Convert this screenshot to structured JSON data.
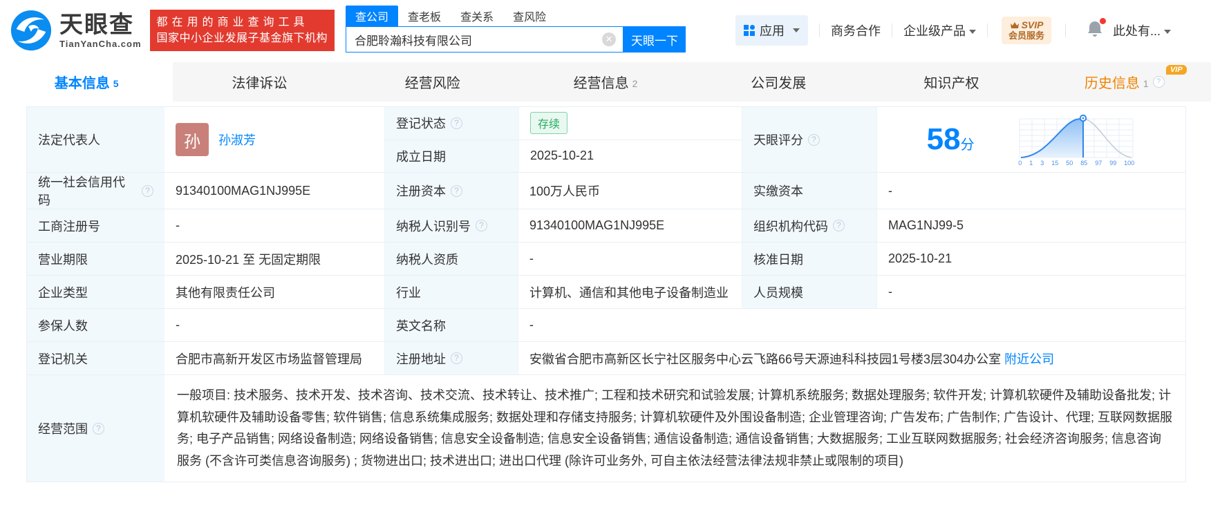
{
  "header": {
    "brand_cn": "天眼查",
    "brand_en": "TianYanCha.com",
    "slogan_line1": "都在用的商业查询工具",
    "slogan_line2": "国家中小企业发展子基金旗下机构",
    "search": {
      "tabs": [
        {
          "label": "查公司",
          "active": true
        },
        {
          "label": "查老板",
          "active": false
        },
        {
          "label": "查关系",
          "active": false
        },
        {
          "label": "查风险",
          "active": false
        }
      ],
      "value": "合肥聆瀚科技有限公司",
      "button": "天眼一下"
    },
    "nav": {
      "apps": "应用",
      "cooperation": "商务合作",
      "enterprise": "企业级产品",
      "svip_line1": "SVIP",
      "svip_line2": "会员服务",
      "user": "此处有..."
    }
  },
  "tabbar": {
    "tabs": [
      {
        "id": "basic",
        "label": "基本信息",
        "count": "5",
        "active": true
      },
      {
        "id": "lawsuit",
        "label": "法律诉讼"
      },
      {
        "id": "risk",
        "label": "经营风险"
      },
      {
        "id": "operating",
        "label": "经营信息",
        "count": "2"
      },
      {
        "id": "development",
        "label": "公司发展"
      },
      {
        "id": "ip",
        "label": "知识产权"
      },
      {
        "id": "history",
        "label": "历史信息",
        "count": "1",
        "vip": true,
        "vip_tag": "VIP",
        "help": true
      }
    ]
  },
  "table": {
    "legal_rep_label": "法定代表人",
    "legal_rep_avatar": "孙",
    "legal_rep_name": "孙淑芳",
    "reg_status_label": "登记状态",
    "reg_status_value": "存续",
    "est_date_label": "成立日期",
    "est_date_value": "2025-10-21",
    "score_label": "天眼评分",
    "score_value": "58",
    "score_unit": "分",
    "score_ticks": [
      "0",
      "1",
      "3",
      "15",
      "50",
      "85",
      "97",
      "99",
      "100"
    ],
    "credit_code_label": "统一社会信用代码",
    "credit_code_value": "91340100MAG1NJ995E",
    "reg_capital_label": "注册资本",
    "reg_capital_value": "100万人民币",
    "paid_capital_label": "实缴资本",
    "paid_capital_value": "-",
    "reg_number_label": "工商注册号",
    "reg_number_value": "-",
    "taxpayer_id_label": "纳税人识别号",
    "taxpayer_id_value": "91340100MAG1NJ995E",
    "org_code_label": "组织机构代码",
    "org_code_value": "MAG1NJ99-5",
    "business_term_label": "营业期限",
    "business_term_value": "2025-10-21 至 无固定期限",
    "taxpayer_qual_label": "纳税人资质",
    "taxpayer_qual_value": "-",
    "approval_date_label": "核准日期",
    "approval_date_value": "2025-10-21",
    "company_type_label": "企业类型",
    "company_type_value": "其他有限责任公司",
    "industry_label": "行业",
    "industry_value": "计算机、通信和其他电子设备制造业",
    "staff_size_label": "人员规模",
    "staff_size_value": "-",
    "insured_label": "参保人数",
    "insured_value": "-",
    "english_name_label": "英文名称",
    "english_name_value": "-",
    "reg_authority_label": "登记机关",
    "reg_authority_value": "合肥市高新开发区市场监督管理局",
    "reg_address_label": "注册地址",
    "reg_address_value": "安徽省合肥市高新区长宁社区服务中心云飞路66号天源迪科科技园1号楼3层304办公室",
    "nearby_link": "附近公司",
    "scope_label": "经营范围",
    "scope_value": "一般项目: 技术服务、技术开发、技术咨询、技术交流、技术转让、技术推广; 工程和技术研究和试验发展; 计算机系统服务; 数据处理服务; 软件开发; 计算机软硬件及辅助设备批发; 计算机软硬件及辅助设备零售; 软件销售; 信息系统集成服务; 数据处理和存储支持服务; 计算机软硬件及外围设备制造; 企业管理咨询; 广告发布; 广告制作; 广告设计、代理; 互联网数据服务; 电子产品销售; 网络设备制造; 网络设备销售; 信息安全设备制造; 信息安全设备销售; 通信设备制造; 通信设备销售; 大数据服务; 工业互联网数据服务; 社会经济咨询服务; 信息咨询服务 (不含许可类信息咨询服务) ; 货物进出口; 技术进出口; 进出口代理 (除许可业务外, 可自主依法经营法律法规非禁止或限制的项目)"
  }
}
